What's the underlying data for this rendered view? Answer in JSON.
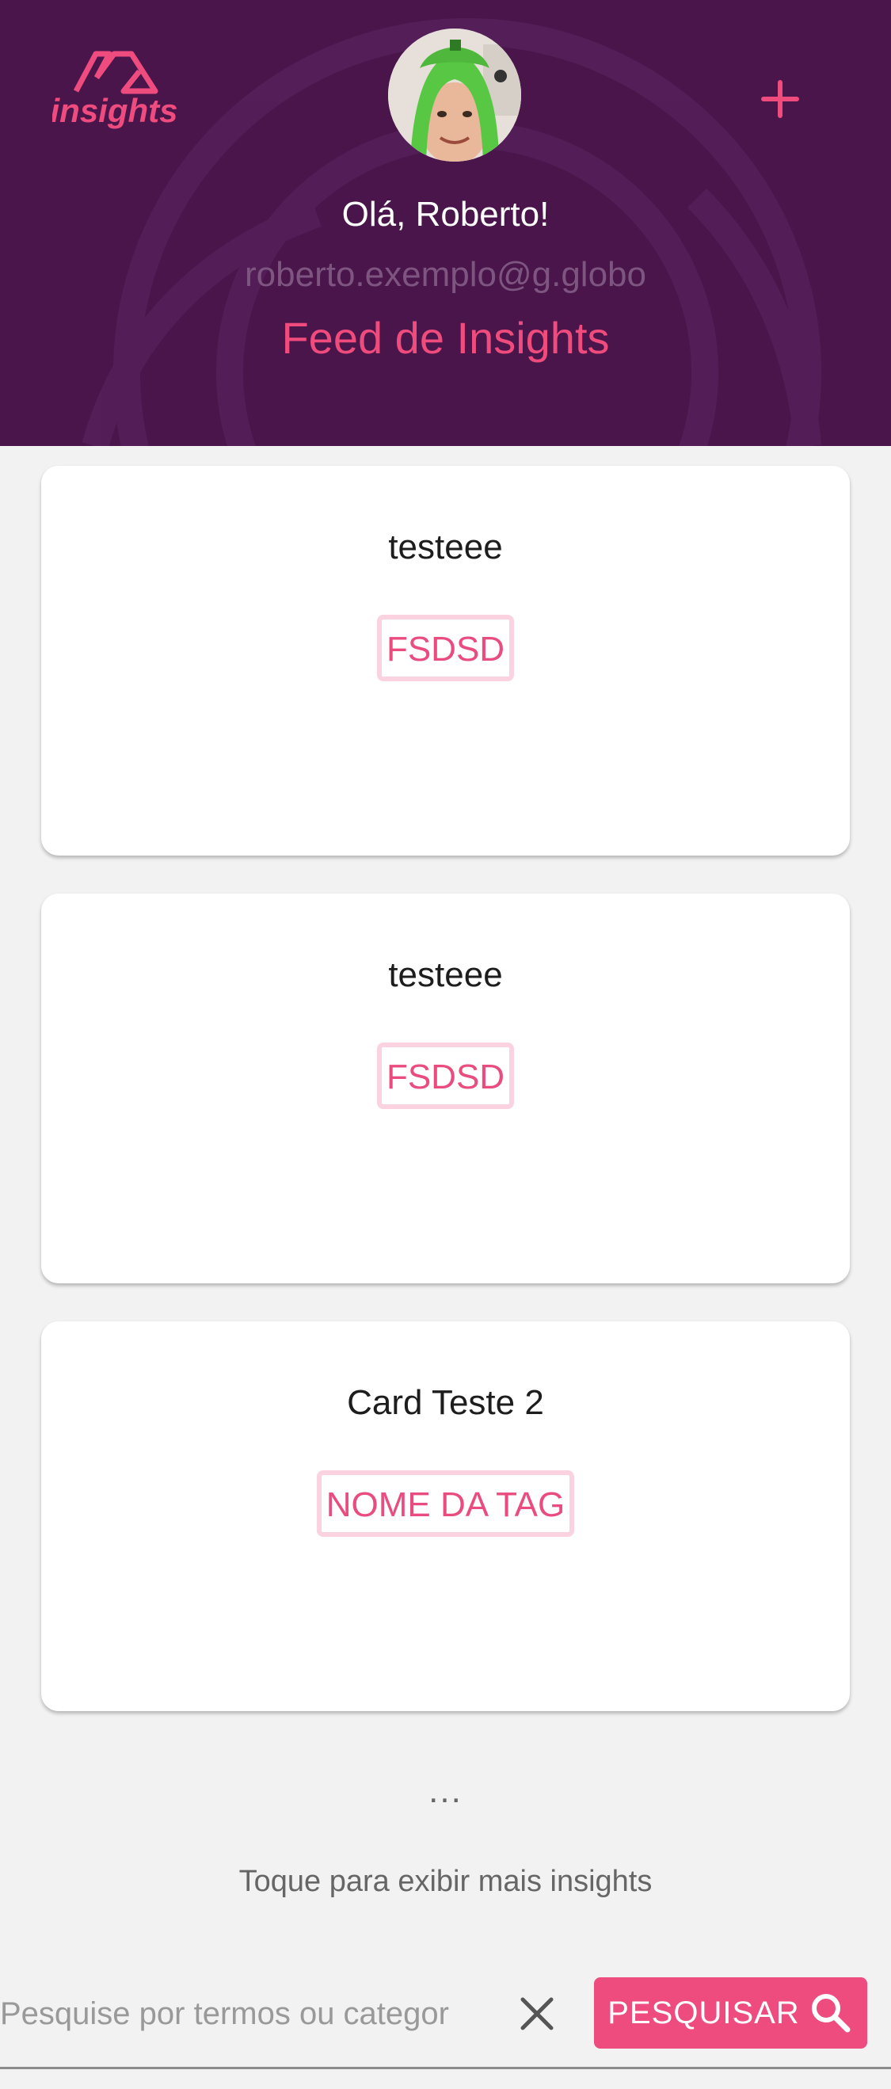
{
  "colors": {
    "header_bg": "#4a154b",
    "accent": "#ef4b7d",
    "tag_border": "#fbd3e0",
    "page_bg": "#f2f2f2"
  },
  "header": {
    "logo_text": "insights",
    "logo_icon": "insights-logo-icon",
    "add_icon": "plus-icon",
    "avatar_icon": "user-avatar",
    "greeting": "Olá, Roberto!",
    "email": "roberto.exemplo@g.globo",
    "title": "Feed de Insights"
  },
  "cards": [
    {
      "title": "testeee",
      "tag": "FSDSD"
    },
    {
      "title": "testeee",
      "tag": "FSDSD"
    },
    {
      "title": "Card Teste 2",
      "tag": "NOME DA TAG"
    }
  ],
  "feed": {
    "ellipsis": "...",
    "load_more": "Toque para exibir mais insights"
  },
  "search": {
    "placeholder": "Pesquise por termos ou categor",
    "clear_icon": "close-icon",
    "button_label": "PESQUISAR",
    "button_icon": "search-icon"
  }
}
